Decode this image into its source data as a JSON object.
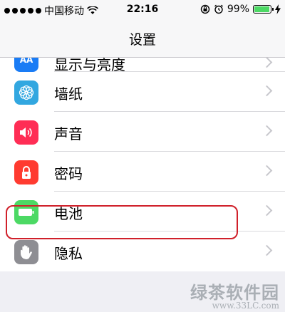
{
  "status_bar": {
    "carrier": "中国移动",
    "time": "22:16",
    "battery_percent": "99%",
    "battery_level": 0.99,
    "accent": "#4cd964"
  },
  "nav": {
    "title": "设置"
  },
  "rows": [
    {
      "label": "显示与亮度",
      "icon": "display-brightness-icon",
      "color": "#1a7cf5"
    },
    {
      "label": "墙纸",
      "icon": "wallpaper-flower-icon",
      "color": "#32a7e0"
    },
    {
      "label": "声音",
      "icon": "speaker-icon",
      "color": "#ff2d55"
    },
    {
      "label": "密码",
      "icon": "lock-icon",
      "color": "#ff3b30"
    },
    {
      "label": "电池",
      "icon": "battery-icon",
      "color": "#4cd964"
    },
    {
      "label": "隐私",
      "icon": "hand-icon",
      "color": "#8e8e93"
    }
  ],
  "display_icon_text": "AA",
  "highlight_color": "#d0202a",
  "watermark": {
    "text": "绿茶软件园",
    "url": "www.33LC.com"
  }
}
